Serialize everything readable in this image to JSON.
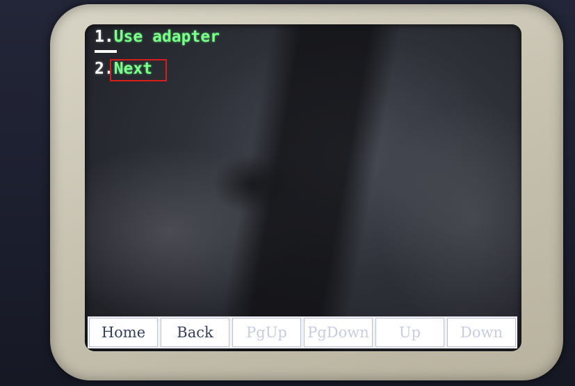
{
  "menu": {
    "items": [
      {
        "number": "1.",
        "label": "Use adapter"
      },
      {
        "number": "2.",
        "label": "Next"
      }
    ]
  },
  "toolbar": {
    "buttons": [
      {
        "label": "Home",
        "enabled": true
      },
      {
        "label": "Back",
        "enabled": true
      },
      {
        "label": "PgUp",
        "enabled": false
      },
      {
        "label": "PgDown",
        "enabled": false
      },
      {
        "label": "Up",
        "enabled": false
      },
      {
        "label": "Down",
        "enabled": false
      }
    ]
  },
  "colors": {
    "menu_text": "#7dff8a",
    "highlight_box": "#d91c1c",
    "toolbar_text": "#34405c"
  }
}
